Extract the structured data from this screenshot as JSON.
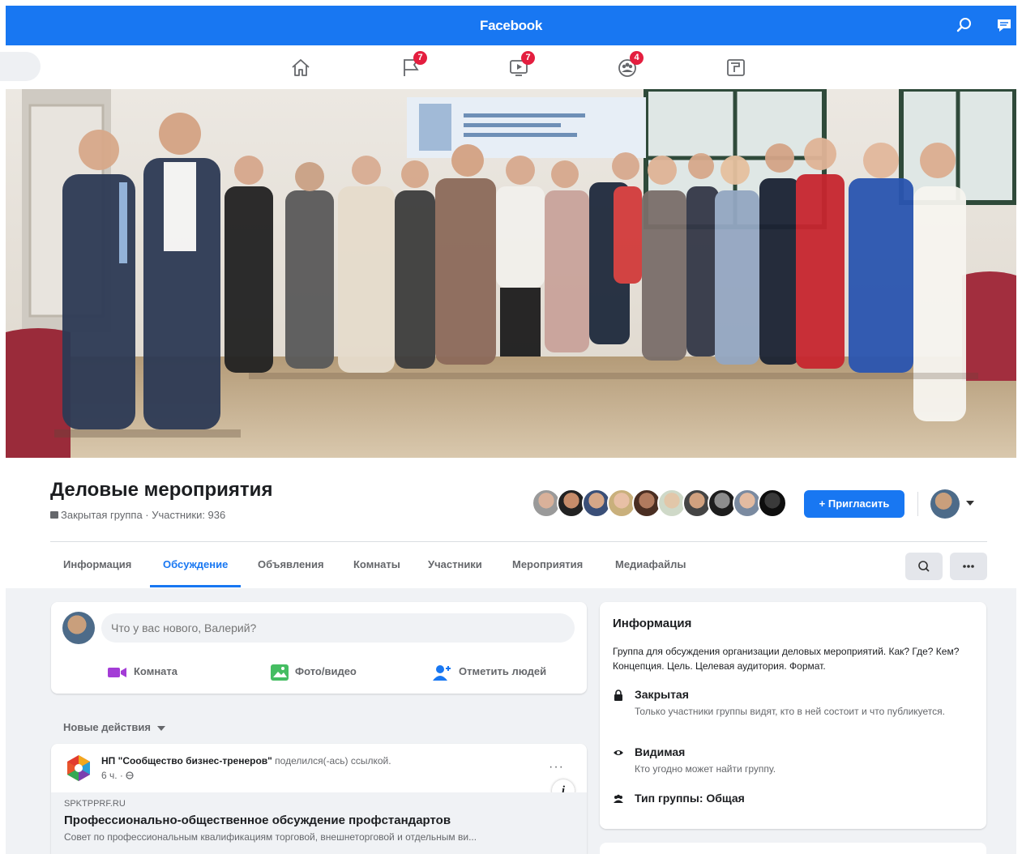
{
  "app": {
    "title": "Facebook"
  },
  "nav": {
    "items": [
      {
        "name": "home",
        "icon": "home-icon",
        "badge": ""
      },
      {
        "name": "pages",
        "icon": "flag-icon",
        "badge": "7"
      },
      {
        "name": "watch",
        "icon": "video-icon",
        "badge": "7"
      },
      {
        "name": "groups",
        "icon": "groups-icon",
        "badge": "4"
      },
      {
        "name": "gaming",
        "icon": "gaming-icon",
        "badge": ""
      }
    ]
  },
  "group": {
    "title": "Деловые мероприятия",
    "meta": "Закрытая группа · Участники: 936",
    "invite_label": "+ Пригласить"
  },
  "tabs": [
    {
      "label": "Информация",
      "active": false
    },
    {
      "label": "Обсуждение",
      "active": true
    },
    {
      "label": "Объявления",
      "active": false
    },
    {
      "label": "Комнаты",
      "active": false
    },
    {
      "label": "Участники",
      "active": false
    },
    {
      "label": "Мероприятия",
      "active": false
    },
    {
      "label": "Медиафайлы",
      "active": false
    }
  ],
  "composer": {
    "placeholder": "Что у вас нового, Валерий?",
    "actions": {
      "room": "Комната",
      "photo": "Фото/видео",
      "tag": "Отметить людей"
    }
  },
  "feed": {
    "new_activity_label": "Новые действия",
    "post": {
      "author": "НП \"Сообщество бизнес-тренеров\"",
      "shared_text": " поделился(-ась) ссылкой.",
      "time": "6 ч. · ",
      "more": "···",
      "info": "i",
      "link": {
        "domain": "SPKTPPRF.RU",
        "title": "Профессионально-общественное обсуждение профстандартов",
        "desc": "Совет по профессиональным квалификациям торговой, внешнеторговой и отдельным ви..."
      }
    }
  },
  "info_card": {
    "heading": "Информация",
    "description": "Группа для обсуждения организации деловых мероприятий. Как? Где? Кем? Концепция. Цель. Целевая аудитория. Формат.",
    "closed_title": "Закрытая",
    "closed_sub": "Только участники группы видят, кто в ней состоит и что публикуется.",
    "visible_title": "Видимая",
    "visible_sub": "Кто угодно может найти группу.",
    "type_title": "Тип группы: Общая"
  },
  "colors": {
    "brand": "#1877f2",
    "badge": "#e41e3f",
    "bg": "#f0f2f5"
  }
}
